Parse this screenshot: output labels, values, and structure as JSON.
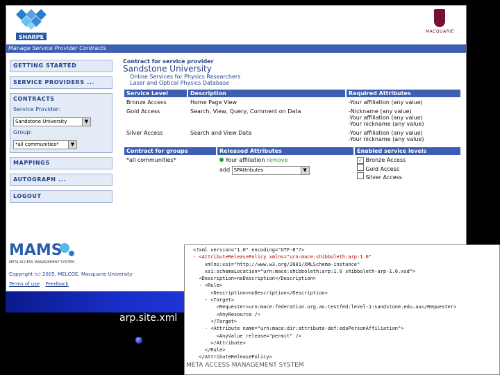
{
  "header": {
    "logo_text": "SHARPE",
    "institution": "MACQUARIE",
    "title_bar": "Manage Service Provider Contracts"
  },
  "sidebar": {
    "getting_started": "GETTING STARTED",
    "service_providers": "SERVICE PROVIDERS ...",
    "contracts": "CONTRACTS",
    "service_provider_label": "Service Provider:",
    "service_provider_value": "Sandstone University",
    "group_label": "Group:",
    "group_value": "*all communities*",
    "mappings": "MAPPINGS",
    "autograph": "AUTOGRAPH ...",
    "logout": "LOGOUT"
  },
  "contract": {
    "heading": "Contract for service provider",
    "university": "Sandstone University",
    "links": [
      "Online Services for Physics Researchers",
      "Laser and Optical Physics Database"
    ]
  },
  "service_table": {
    "headers": [
      "Service Level",
      "Description",
      "Required Attributes"
    ],
    "rows": [
      {
        "level": "Bronze Access",
        "desc": "Home Page View",
        "attrs": [
          "-Your affiliation (any value)"
        ]
      },
      {
        "level": "Gold Access",
        "desc": "Search, View, Query, Comment on Data",
        "attrs": [
          "-Nickname (any value)",
          "-Your affiliation (any value)",
          "-Your nickname (any value)"
        ]
      },
      {
        "level": "Silver Access",
        "desc": "Search and View Data",
        "attrs": [
          "-Your affiliation (any value)",
          "-Your nickname (any value)"
        ]
      }
    ]
  },
  "groups_table": {
    "headers": [
      "Contract for groups",
      "Released Attributes",
      "Enabled service levels"
    ],
    "group": "*all communities*",
    "released_attribute": "Your affiliation",
    "remove_label": "remove",
    "add_label": "add",
    "add_select_value": "SPAttributes",
    "levels": [
      {
        "label": "Bronze Access",
        "checked": true
      },
      {
        "label": "Gold Access",
        "checked": false
      },
      {
        "label": "Silver Access",
        "checked": false
      }
    ]
  },
  "footer": {
    "mams_text": "MAMS",
    "mams_sub": "META ACCESS MANAGEMENT SYSTEM",
    "copyright": "Copyright (c) 2005, MELCOE, Macquarie University",
    "terms": "Terms of use",
    "feedback": "Feedback"
  },
  "xml_lines": [
    "<?xml version=\"1.0\" encoding=\"UTF-8\"?>",
    "- <AttributeReleasePolicy xmlns=\"urn:mace:shibboleth:arp:1.0\"",
    "    xmlns:xsi=\"http://www.w3.org/2001/XMLSchema-instance\"",
    "    xsi:schemaLocation=\"urn:mace:shibboleth:arp:1.0 shibboleth-arp-1.0.xsd\">",
    "  <Description>noDescription</Description>",
    "  - <Rule>",
    "      <Description>noDescription</Description>",
    "    - <Target>",
    "        <Requester>urn:mace:federation.org.au:testfed:level-1:sandstone.edu.au</Requester>",
    "        <AnyResource />",
    "      </Target>",
    "    - <Attribute name=\"urn:mace:dir:attribute-def:eduPersonAffiliation\">",
    "        <AnyValue release=\"permit\" />",
    "      </Attribute>",
    "    </Rule>",
    "  </AttributeReleasePolicy>"
  ],
  "caption": "arp.site.xml",
  "slide_footer": "META ACCESS MANAGEMENT SYSTEM"
}
